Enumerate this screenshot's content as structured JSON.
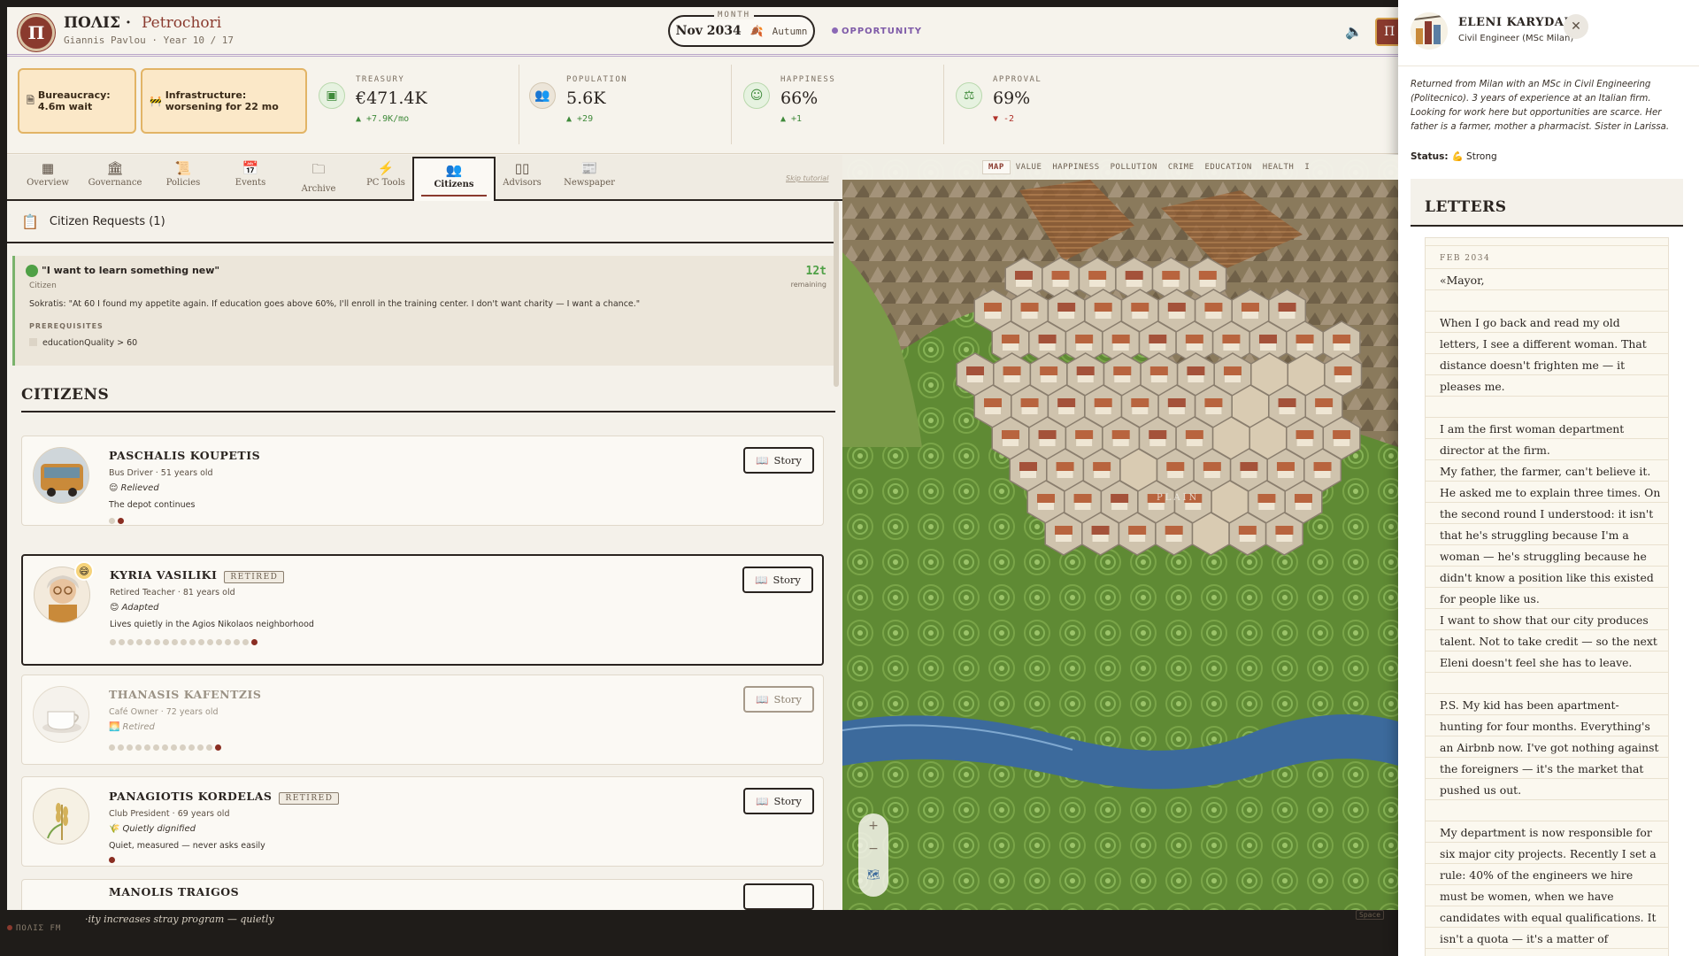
{
  "header": {
    "logo": "Π",
    "game_name": "ΠΟΛΙΣ ·",
    "city": "Petrochori",
    "subtitle": "Giannis Pavlou · Year 10 / 17",
    "month_caption": "MONTH",
    "month": "Nov 2034",
    "season": "Autumn",
    "opportunity": "OPPORTUNITY",
    "user_initial": "Π"
  },
  "alerts": {
    "bureaucracy": "Bureaucracy: 4.6m wait",
    "infrastructure": "Infrastructure: worsening for 22 mo"
  },
  "stats": {
    "treasury": {
      "label": "TREASURY",
      "value": "€471.4K",
      "delta": "▲ +7.9K/mo"
    },
    "population": {
      "label": "POPULATION",
      "value": "5.6K",
      "delta": "▲ +29"
    },
    "happiness": {
      "label": "HAPPINESS",
      "value": "66%",
      "delta": "▲ +1"
    },
    "approval": {
      "label": "APPROVAL",
      "value": "69%",
      "delta": "▼ -2"
    }
  },
  "tabs": [
    "Overview",
    "Governance",
    "Policies",
    "Events",
    "Archive",
    "PC Tools",
    "Citizens",
    "Advisors",
    "Newspaper"
  ],
  "skip_tutorial": "Skip tutorial",
  "requests": {
    "title": "Citizen Requests (1)",
    "quote": "\"I want to learn something new\"",
    "who": "Citizen",
    "turns": "12t",
    "remaining": "remaining",
    "body": "Sokratis: \"At 60 I found my appetite again. If education goes above 60%, I'll enroll in the training center. I don't want charity — I want a chance.\"",
    "prereq_label": "PREREQUISITES",
    "prereq": "educationQuality > 60"
  },
  "citizens_title": "CITIZENS",
  "story_label": "Story",
  "retired_label": "RETIRED",
  "citizens": [
    {
      "name": "PASCHALIS KOUPETIS",
      "role": "Bus Driver · 51 years old",
      "mood_icon": "😌",
      "mood": "Relieved",
      "story": "The depot continues",
      "dots_total": 2,
      "dots_on": 1
    },
    {
      "name": "KYRIA VASILIKI",
      "role": "Retired Teacher · 81 years old",
      "mood_icon": "😊",
      "mood": "Adapted",
      "story": "Lives quietly in the Agios Nikolaos neighborhood",
      "dots_total": 17,
      "dots_on": 1
    },
    {
      "name": "THANASIS KAFENTZIS",
      "role": "Café Owner · 72 years old",
      "mood_icon": "🌅",
      "mood": "Retired",
      "story": "",
      "dots_total": 13,
      "dots_on": 1
    },
    {
      "name": "PANAGIOTIS KORDELAS",
      "role": "Club President · 69 years old",
      "mood_icon": "🌾",
      "mood": "Quietly dignified",
      "story": "Quiet, measured — never asks easily",
      "dots_total": 1,
      "dots_on": 1
    },
    {
      "name": "MANOLIS TRAIGOS"
    }
  ],
  "map": {
    "tabs": [
      "MAP",
      "VALUE",
      "HAPPINESS",
      "POLLUTION",
      "CRIME",
      "EDUCATION",
      "HEALTH",
      "I"
    ],
    "region_label": "PLAIN",
    "zoom_in": "+",
    "zoom_out": "−"
  },
  "ticker": {
    "radio": "ΠΟΛΙΣ FM",
    "text": "·ity increases stray program — quietly",
    "space_hint": "Space"
  },
  "drawer": {
    "name": "ELENI KARYDAKI",
    "role": "Civil Engineer (MSc Milan)",
    "bio": "Returned from Milan with an MSc in Civil Engineering (Politecnico). 3 years of experience at an Italian firm. Looking for work here but opportunities are scarce. Her father is a farmer, mother a pharmacist. Sister in Larissa.",
    "status_label": "Status:",
    "status_icon": "💪",
    "status": "Strong",
    "letters_title": "LETTERS",
    "letter_date": "FEB 2034",
    "letter_body": "«Mayor,\n\nWhen I go back and read my old letters, I see a different woman. That distance doesn't frighten me — it pleases me.\n\nI am the first woman department director at the firm.\nMy father, the farmer, can't believe it. He asked me to explain three times. On the second round I understood: it isn't that he's struggling because I'm a woman — he's struggling because he didn't know a position like this existed for people like us.\nI want to show that our city produces talent. Not to take credit — so the next Eleni doesn't feel she has to leave.\n\nP.S. My kid has been apartment-hunting for four months. Everything's an Airbnb now. I've got nothing against the foreigners — it's the market that pushed us out.\n\nMy department is now responsible for six major city projects. Recently I set a rule: 40% of the engineers we hire must be women, when we have candidates with equal qualifications. It isn't a quota — it's a matter of"
  }
}
